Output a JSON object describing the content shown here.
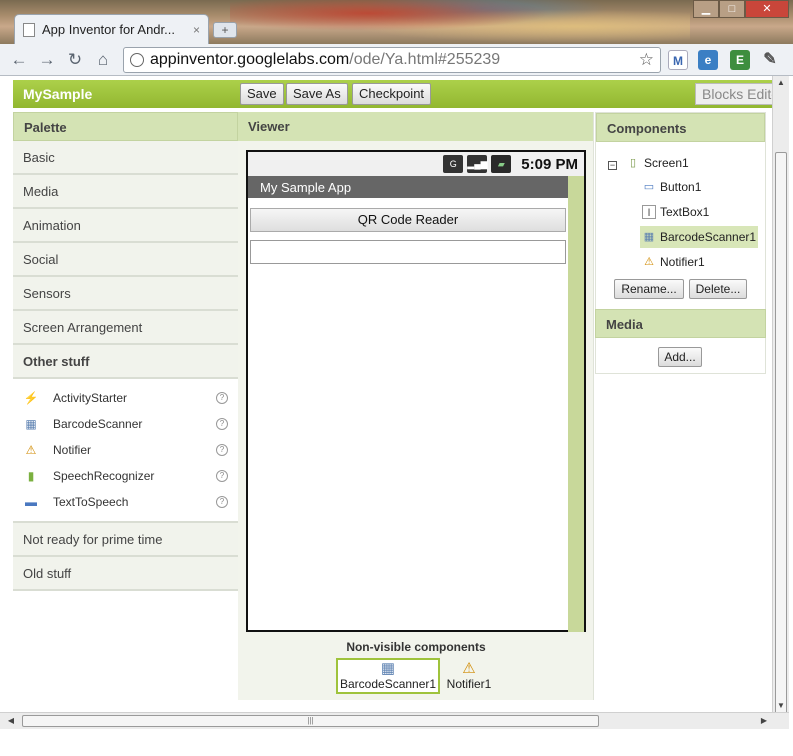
{
  "browser": {
    "tab_title": "App Inventor for Andr...",
    "tab_close": "×",
    "new_tab": "+",
    "minimize": "▁",
    "maximize": "□",
    "close": "✕",
    "back": "←",
    "forward": "→",
    "reload": "↻",
    "home": "⌂",
    "url_host": "appinventor.googlelabs.com",
    "url_path": "/ode/Ya.html#255239",
    "star": "☆",
    "wrench": "✎"
  },
  "appbar": {
    "project_name": "MySample",
    "save": "Save",
    "save_as": "Save As",
    "checkpoint": "Checkpoint",
    "blocks_editor": "Blocks Editor"
  },
  "palette": {
    "title": "Palette",
    "categories_top": [
      "Basic",
      "Media",
      "Animation",
      "Social",
      "Sensors",
      "Screen Arrangement"
    ],
    "open_category": "Other stuff",
    "items": [
      {
        "label": "ActivityStarter",
        "icon": "⚡",
        "color": "#e0a020"
      },
      {
        "label": "BarcodeScanner",
        "icon": "▦",
        "color": "#5a7fb0"
      },
      {
        "label": "Notifier",
        "icon": "⚠",
        "color": "#d08a00"
      },
      {
        "label": "SpeechRecognizer",
        "icon": "▮",
        "color": "#7bb040"
      },
      {
        "label": "TextToSpeech",
        "icon": "▬",
        "color": "#4a78c0"
      }
    ],
    "help_glyph": "?",
    "categories_bottom": [
      "Not ready for prime time",
      "Old stuff"
    ]
  },
  "viewer": {
    "title": "Viewer",
    "time": "5:09 PM",
    "app_title": "My Sample App",
    "button_text": "QR Code Reader",
    "nonvisible_title": "Non-visible components",
    "nonvisible": [
      {
        "label": "BarcodeScanner1",
        "icon": "▦"
      },
      {
        "label": "Notifier1",
        "icon": "⚠"
      }
    ]
  },
  "components": {
    "title": "Components",
    "collapse": "−",
    "tree": [
      {
        "label": "Screen1",
        "icon": "▯"
      },
      {
        "label": "Button1",
        "icon": "▭"
      },
      {
        "label": "TextBox1",
        "icon": "I"
      },
      {
        "label": "BarcodeScanner1",
        "icon": "▦"
      },
      {
        "label": "Notifier1",
        "icon": "⚠"
      }
    ],
    "rename": "Rename...",
    "delete": "Delete..."
  },
  "media": {
    "title": "Media",
    "add": "Add..."
  },
  "colors": {
    "accent_green": "#9fc33c",
    "header_green": "#d4e3b4"
  }
}
